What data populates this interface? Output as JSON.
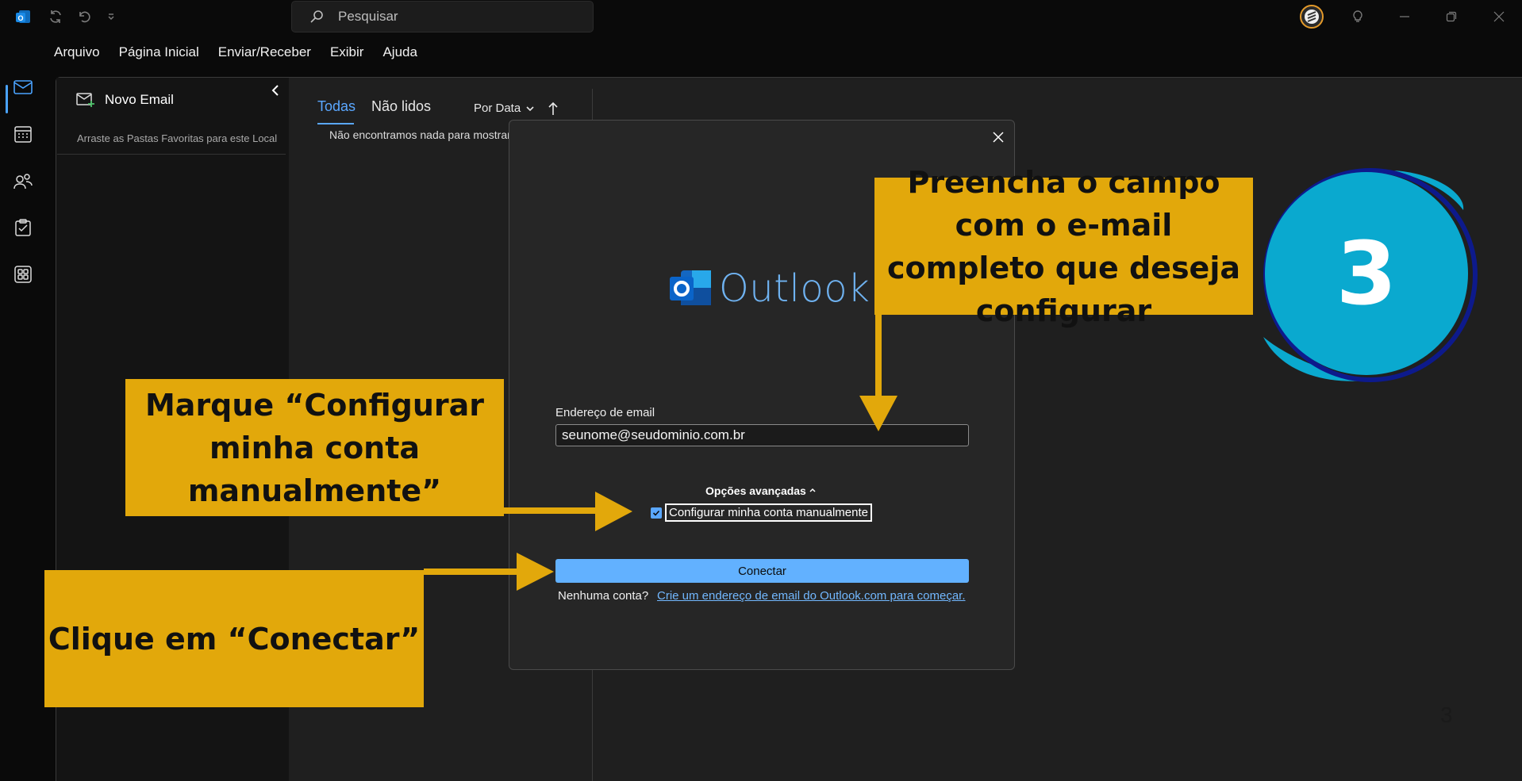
{
  "search": {
    "placeholder": "Pesquisar"
  },
  "menu": {
    "items": [
      "Arquivo",
      "Página Inicial",
      "Enviar/Receber",
      "Exibir",
      "Ajuda"
    ]
  },
  "rail": {
    "items": [
      "mail-icon",
      "calendar-icon",
      "people-icon",
      "tasks-icon",
      "apps-icon"
    ]
  },
  "folder_pane": {
    "new_email": "Novo Email",
    "favorites_hint": "Arraste as Pastas Favoritas para este Local"
  },
  "message_list": {
    "tabs": [
      "Todas",
      "Não lidos"
    ],
    "sort": "Por Data",
    "empty": "Não encontramos nada para mostrar a"
  },
  "dialog": {
    "brand": "Outlook",
    "email_label": "Endereço de email",
    "email_value": "seunome@seudominio.com.br",
    "advanced_options": "Opções avançadas",
    "manual_setup": "Configurar minha conta manualmente",
    "manual_setup_checked": true,
    "connect": "Conectar",
    "no_account": "Nenhuma conta?",
    "create_link": "Crie um endereço de email do Outlook.com para começar."
  },
  "annotations": {
    "fill_email": "Preencha o campo com o e-mail completo que deseja configurar",
    "mark_manual": "Marque “Configurar minha conta manualmente”",
    "click_connect": "Clique em “Conectar”",
    "step_number": "3",
    "callout_color": "#e2a80b",
    "badge_color": "#0aa9cf"
  },
  "page_number": "3",
  "colors": {
    "accent": "#5aa7ff",
    "connect_button": "#62b1ff"
  }
}
